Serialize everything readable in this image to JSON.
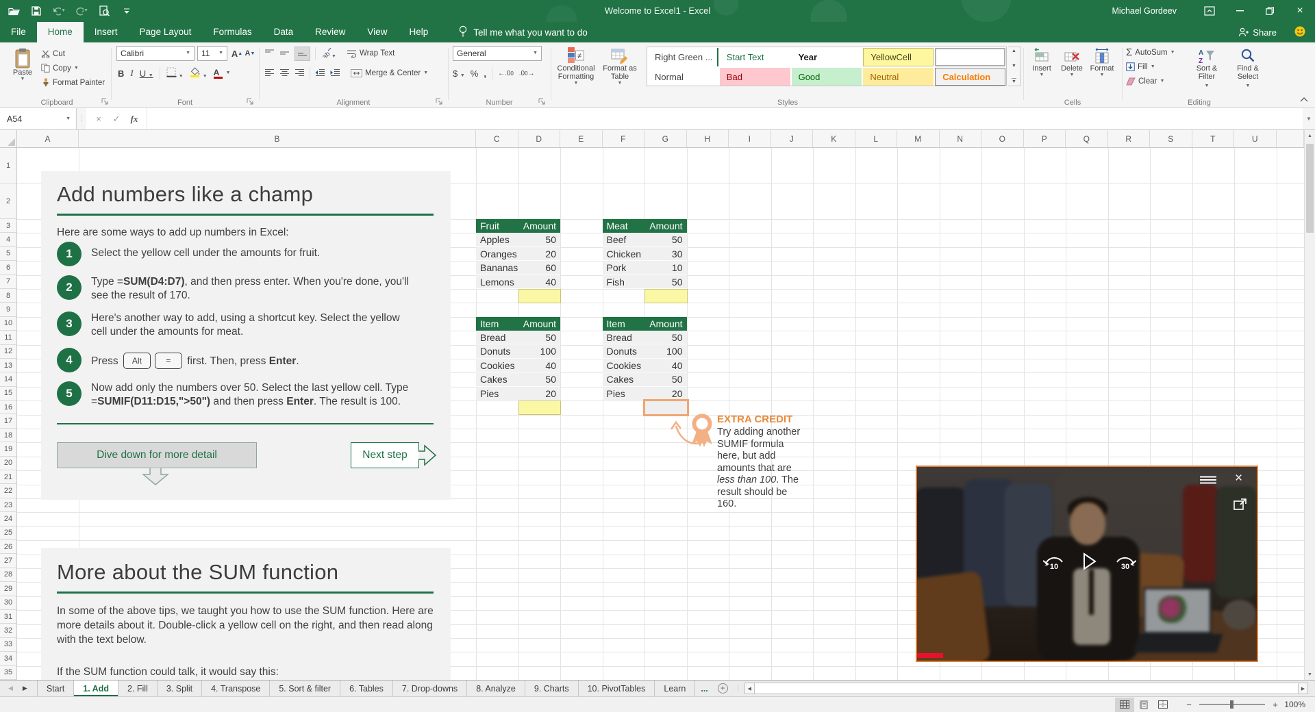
{
  "titlebar": {
    "title": "Welcome to Excel1 - Excel",
    "user": "Michael Gordeev"
  },
  "menu": {
    "tabs": [
      "File",
      "Home",
      "Insert",
      "Page Layout",
      "Formulas",
      "Data",
      "Review",
      "View",
      "Help"
    ],
    "active_tab": "Home",
    "tell_me": "Tell me what you want to do",
    "share": "Share"
  },
  "ribbon": {
    "clipboard": {
      "label": "Clipboard",
      "paste": "Paste",
      "cut": "Cut",
      "copy": "Copy",
      "format_painter": "Format Painter"
    },
    "font": {
      "label": "Font",
      "font_name": "Calibri",
      "font_size": "11"
    },
    "alignment": {
      "label": "Alignment",
      "wrap_text": "Wrap Text",
      "merge_center": "Merge & Center"
    },
    "number": {
      "label": "Number",
      "format": "General"
    },
    "styles": {
      "label": "Styles",
      "conditional_formatting": "Conditional Formatting",
      "format_as_table": "Format as Table",
      "gallery": [
        {
          "label": "Right Green ...",
          "cls": "s-rightgreen"
        },
        {
          "label": "Start Text",
          "cls": "s-starttext"
        },
        {
          "label": "Year",
          "cls": "s-year"
        },
        {
          "label": "YellowCell",
          "cls": "s-yellowcell"
        },
        {
          "label": "",
          "cls": "s-blank"
        },
        {
          "label": "Normal",
          "cls": "s-normal"
        },
        {
          "label": "Bad",
          "cls": "s-bad"
        },
        {
          "label": "Good",
          "cls": "s-good"
        },
        {
          "label": "Neutral",
          "cls": "s-neutral"
        },
        {
          "label": "Calculation",
          "cls": "s-calc"
        }
      ]
    },
    "cells": {
      "label": "Cells",
      "insert": "Insert",
      "delete": "Delete",
      "format": "Format"
    },
    "editing": {
      "label": "Editing",
      "autosum": "AutoSum",
      "fill": "Fill",
      "clear": "Clear",
      "sort_filter": "Sort & Filter",
      "find_select": "Find & Select"
    }
  },
  "formula_bar": {
    "name_box": "A54",
    "formula": ""
  },
  "grid": {
    "columns": [
      "A",
      "B",
      "C",
      "D",
      "E",
      "F",
      "G",
      "H",
      "I",
      "J",
      "K",
      "L",
      "M",
      "N",
      "O",
      "P",
      "Q",
      "R",
      "S",
      "T",
      "U"
    ],
    "rows": [
      1,
      2,
      3,
      4,
      5,
      6,
      7,
      8,
      9,
      10,
      11,
      12,
      13,
      14,
      15,
      16,
      17,
      18,
      19,
      20,
      21,
      22,
      23,
      24,
      25,
      26,
      27,
      28,
      29,
      30,
      31,
      32,
      33,
      34,
      35
    ]
  },
  "content": {
    "panel1": {
      "title": "Add numbers like a champ",
      "intro": "Here are some ways to add up numbers in Excel:",
      "steps": [
        {
          "num": "1",
          "segs": [
            {
              "t": "Select the yellow cell under the amounts for f"
            },
            {
              "t": "ruit."
            }
          ]
        },
        {
          "num": "2",
          "segs": [
            {
              "t": "Type ="
            },
            {
              "t": "SUM(D4:D7)",
              "b": 1
            },
            {
              "t": ", and then press enter. When you're done, you'll see the result of 170."
            }
          ]
        },
        {
          "num": "3",
          "segs": [
            {
              "t": "Here's another way to add, using a shortcut key. Select the yellow cell under the amounts for meat."
            }
          ]
        },
        {
          "num": "4",
          "segs": [
            {
              "t": "Press "
            },
            {
              "k": "Alt"
            },
            {
              "k": "="
            },
            {
              "t": " first. Then, press "
            },
            {
              "t": "Enter",
              "b": 1
            },
            {
              "t": "."
            }
          ]
        },
        {
          "num": "5",
          "segs": [
            {
              "t": "Now add only the numbers over 50. Select the last yellow cell. Type ="
            },
            {
              "t": "SUMIF(D11:D15,\">50\")",
              "b": 1
            },
            {
              "t": " and then press "
            },
            {
              "t": "Enter",
              "b": 1
            },
            {
              "t": ". The result is 100."
            }
          ]
        }
      ],
      "dive_button": "Dive down for more detail",
      "next_button": "Next step"
    },
    "panel2": {
      "title": "More about the SUM function",
      "para1": "In some of the above tips, we taught you how to use the SUM function. Here are more details about it. Double-click a yellow cell on the right, and then read along with the text below.",
      "para2": "If the SUM function could talk, it would say this:"
    },
    "tables": [
      {
        "name": "fruit",
        "headers": [
          "Fruit",
          "Amount"
        ],
        "rows": [
          [
            "Apples",
            "50"
          ],
          [
            "Oranges",
            "20"
          ],
          [
            "Bananas",
            "60"
          ],
          [
            "Lemons",
            "40"
          ]
        ],
        "footer": "yellow"
      },
      {
        "name": "meat",
        "headers": [
          "Meat",
          "Amount"
        ],
        "rows": [
          [
            "Beef",
            "50"
          ],
          [
            "Chicken",
            "30"
          ],
          [
            "Pork",
            "10"
          ],
          [
            "Fish",
            "50"
          ]
        ],
        "footer": "yellow"
      },
      {
        "name": "items-1",
        "headers": [
          "Item",
          "Amount"
        ],
        "rows": [
          [
            "Bread",
            "50"
          ],
          [
            "Donuts",
            "100"
          ],
          [
            "Cookies",
            "40"
          ],
          [
            "Cakes",
            "50"
          ],
          [
            "Pies",
            "20"
          ]
        ],
        "footer": "yellow"
      },
      {
        "name": "items-2",
        "headers": [
          "Item",
          "Amount"
        ],
        "rows": [
          [
            "Bread",
            "50"
          ],
          [
            "Donuts",
            "100"
          ],
          [
            "Cookies",
            "40"
          ],
          [
            "Cakes",
            "50"
          ],
          [
            "Pies",
            "20"
          ]
        ],
        "footer": "orange"
      }
    ],
    "extra_credit": {
      "title": "EXTRA CREDIT",
      "segs": [
        {
          "t": "Try adding another SUMIF formula here, but add amounts that are "
        },
        {
          "t": "less than 100",
          "i": 1
        },
        {
          "t": ". The result should be 160."
        }
      ]
    }
  },
  "video": {
    "rewind_label": "10",
    "forward_label": "30"
  },
  "sheet_tabs": {
    "tabs": [
      "Start",
      "1. Add",
      "2. Fill",
      "3. Split",
      "4. Transpose",
      "5. Sort & filter",
      "6. Tables",
      "7. Drop-downs",
      "8. Analyze",
      "9. Charts",
      "10. PivotTables",
      "Learn"
    ],
    "active_tab": "1. Add",
    "overflow": "..."
  },
  "status_bar": {
    "zoom_level": "100%"
  },
  "colors": {
    "excel_green": "#217346",
    "step_green": "#1E7145",
    "extra_orange": "#E88A3C",
    "video_border": "#E07F38",
    "yellow_cell": "#FAF7A5",
    "orange_cell_border": "#EFA672",
    "bad_bg": "#FFC7CE",
    "good_bg": "#C6EFCE",
    "neutral_bg": "#FFEB9C",
    "calculation_text": "#FA7D00",
    "progress_red": "#E8112D"
  }
}
